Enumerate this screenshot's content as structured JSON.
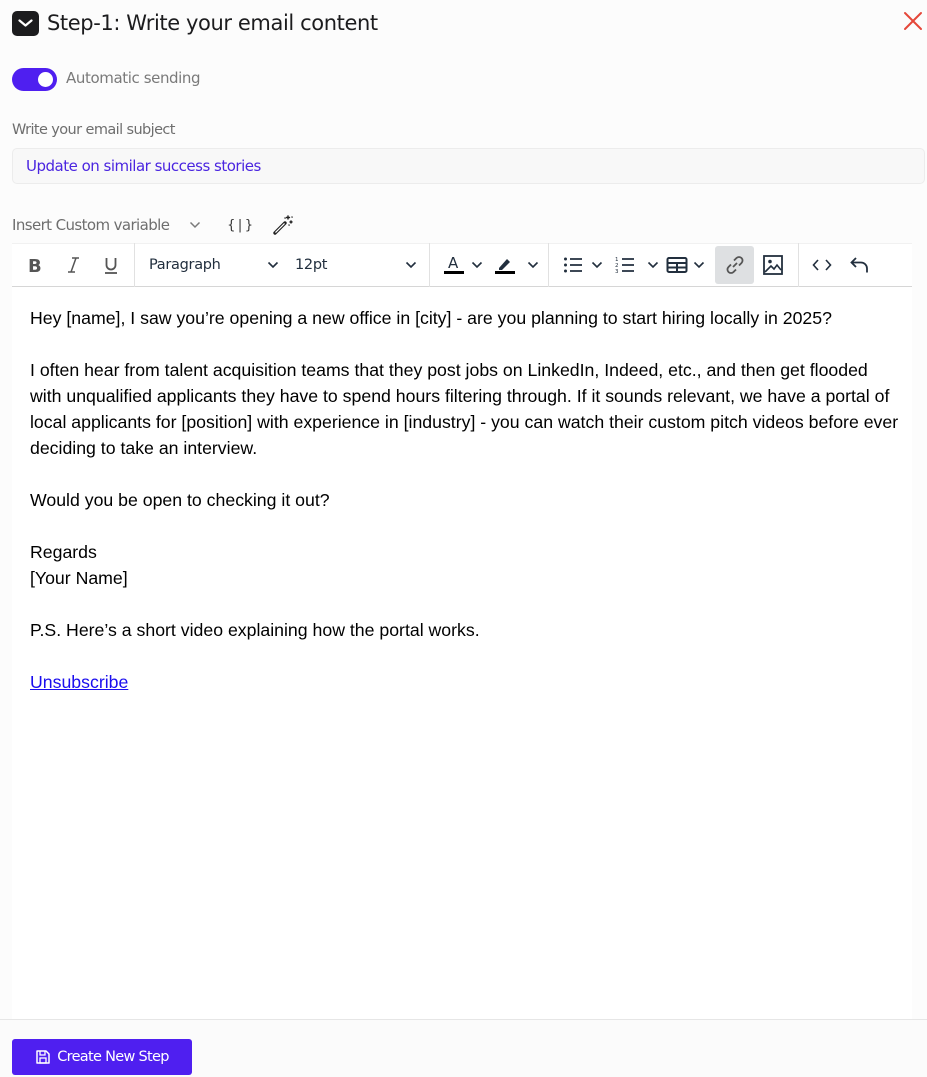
{
  "header": {
    "icon": "mail-icon",
    "title": "Step-1:  Write your email content",
    "close_icon": "close-icon",
    "close_color": "#e5473a"
  },
  "automatic_sending": {
    "label": "Automatic sending",
    "enabled": true,
    "accent_color": "#4f1ff0"
  },
  "subject": {
    "label": "Write your email subject",
    "value": "Update on similar success stories",
    "value_color": "#4a25e0"
  },
  "variables": {
    "select_label": "Insert Custom variable",
    "brace_label": "{|}",
    "brace_icon": "variable-braces-icon",
    "wand_icon": "magic-wand-icon"
  },
  "toolbar": {
    "bold": "bold-icon",
    "italic": "italic-icon",
    "underline": "underline-icon",
    "block_format": "Paragraph",
    "font_size": "12pt",
    "text_color": "text-color-icon",
    "highlight": "highlight-icon",
    "bullet_list": "bullet-list-icon",
    "numbered_list": "numbered-list-icon",
    "table": "table-icon",
    "link": "link-icon",
    "link_active": true,
    "image": "image-icon",
    "code": "source-code-icon",
    "undo": "undo-icon"
  },
  "email_body": {
    "paragraph_1": "Hey [name], I saw you’re opening a new office in [city] - are you planning to start hiring locally in 2025?",
    "paragraph_2": "I often hear from talent acquisition teams that they post jobs on LinkedIn, Indeed, etc., and then get flooded with unqualified applicants they have to spend hours filtering through. If it sounds relevant, we have a portal of local applicants for [position] with experience in [industry] - you can watch their custom pitch videos before ever deciding to take an interview.",
    "paragraph_3": "Would you be open to checking it out?",
    "signoff": "Regards",
    "signature": "[Your Name]",
    "postscript": "P.S. Here’s a short video explaining how the portal works.",
    "unsubscribe_link": "Unsubscribe",
    "link_color": "#1a0dee"
  },
  "footer": {
    "create_button_label": "Create New Step",
    "create_button_icon": "save-icon"
  }
}
